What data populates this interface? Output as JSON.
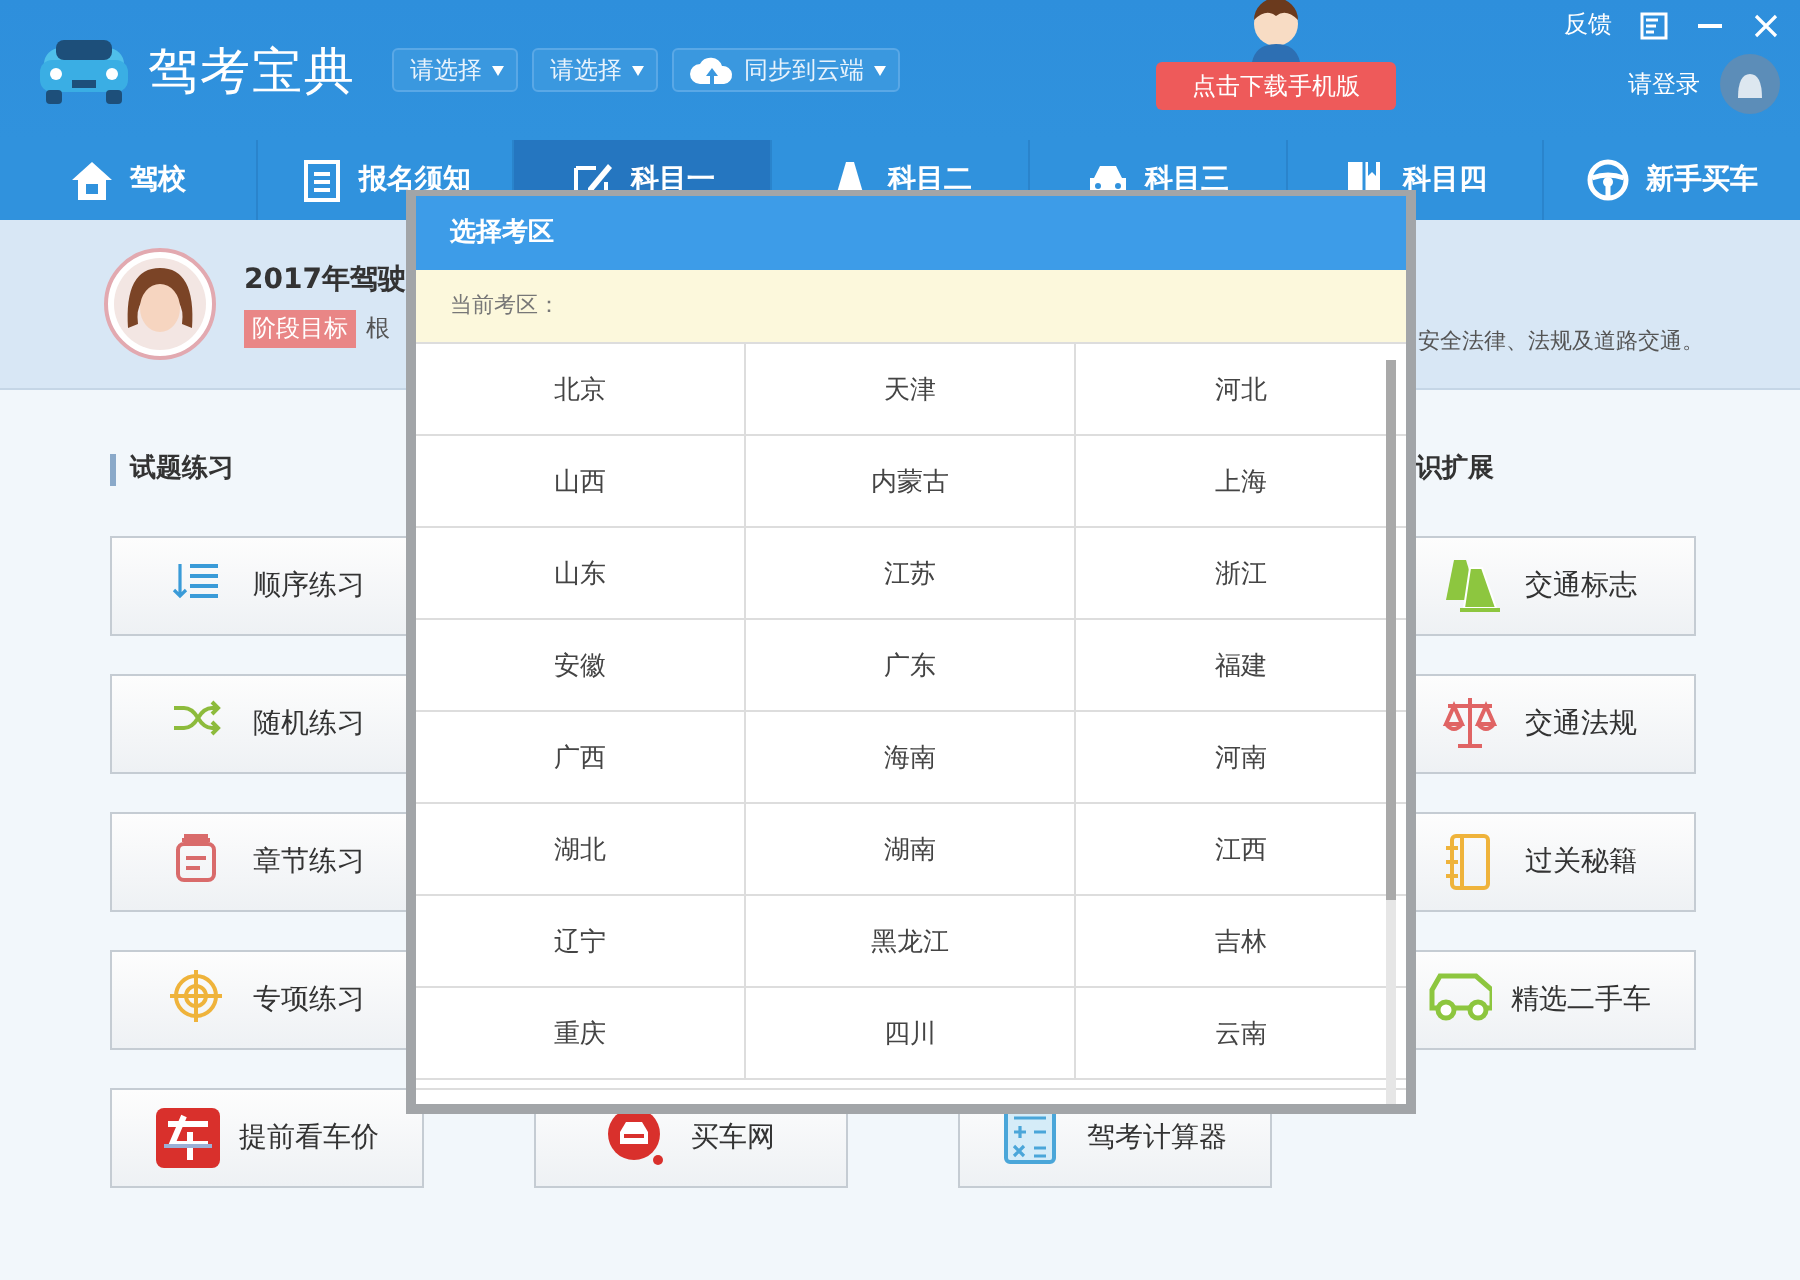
{
  "header": {
    "app_name": "驾考宝典",
    "selectors": [
      "请选择",
      "请选择",
      "同步到云端"
    ],
    "download_button": "点击下载手机版",
    "feedback": "反馈",
    "login": "请登录"
  },
  "tabs": [
    {
      "label": "驾校",
      "selected": false
    },
    {
      "label": "报名须知",
      "selected": false
    },
    {
      "label": "科目一",
      "selected": true
    },
    {
      "label": "科目二",
      "selected": false
    },
    {
      "label": "科目三",
      "selected": false
    },
    {
      "label": "科目四",
      "selected": false
    },
    {
      "label": "新手买车",
      "selected": false
    }
  ],
  "banner": {
    "title": "2017年驾驶",
    "badge": "阶段目标",
    "text": "根",
    "text_right": "安全法律、法规及道路交通。"
  },
  "practice": {
    "heading": "试题练习",
    "buttons": [
      "顺序练习",
      "随机练习",
      "章节练习",
      "专项练习",
      "提前看车价"
    ]
  },
  "middle_buttons": [
    "买车网",
    "驾考计算器"
  ],
  "knowledge": {
    "heading": "识扩展",
    "buttons": [
      "交通标志",
      "交通法规",
      "过关秘籍",
      "精选二手车"
    ]
  },
  "dialog": {
    "title": "选择考区",
    "current_label": "当前考区：",
    "regions": [
      "北京",
      "天津",
      "河北",
      "山西",
      "内蒙古",
      "上海",
      "山东",
      "江苏",
      "浙江",
      "安徽",
      "广东",
      "福建",
      "广西",
      "海南",
      "河南",
      "湖北",
      "湖南",
      "江西",
      "辽宁",
      "黑龙江",
      "吉林",
      "重庆",
      "四川",
      "云南"
    ]
  }
}
